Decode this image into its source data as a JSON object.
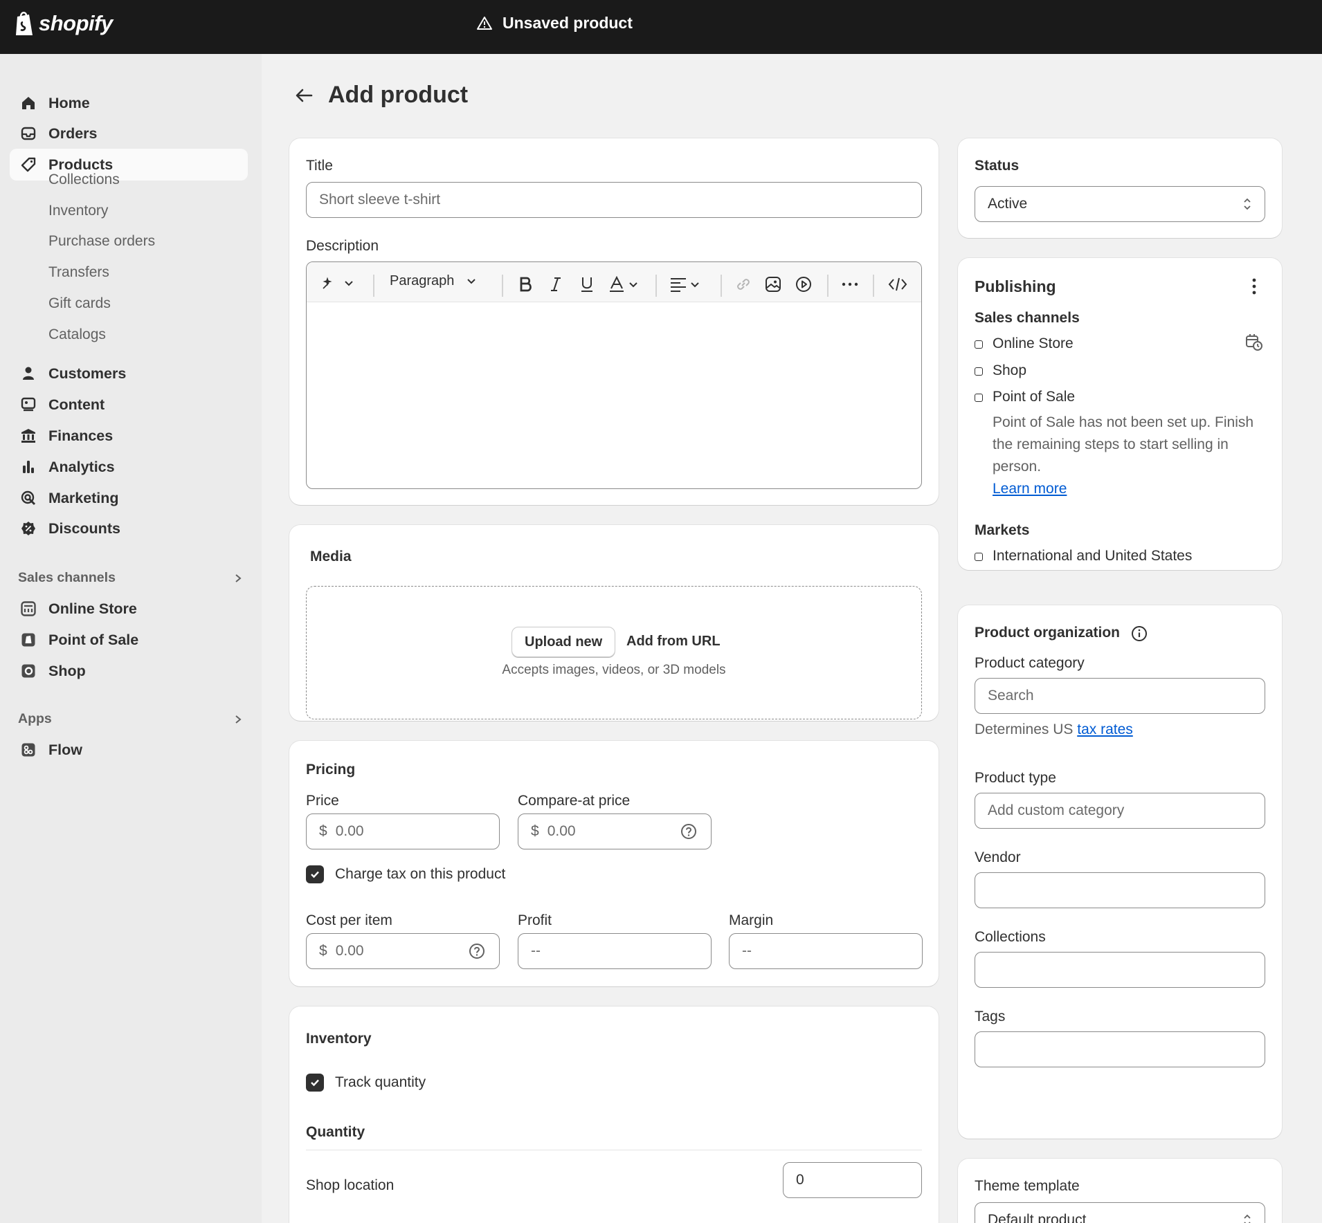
{
  "topbar": {
    "logo_text": "shopify",
    "status_text": "Unsaved product"
  },
  "sidebar": {
    "items": [
      {
        "label": "Home",
        "icon": "home-icon"
      },
      {
        "label": "Orders",
        "icon": "inbox-icon"
      },
      {
        "label": "Products",
        "icon": "tag-icon",
        "active": true
      },
      {
        "label": "Customers",
        "icon": "person-icon"
      },
      {
        "label": "Content",
        "icon": "image-icon"
      },
      {
        "label": "Finances",
        "icon": "bank-icon"
      },
      {
        "label": "Analytics",
        "icon": "bar-chart-icon"
      },
      {
        "label": "Marketing",
        "icon": "target-icon"
      },
      {
        "label": "Discounts",
        "icon": "discount-icon"
      }
    ],
    "product_subitems": [
      "Collections",
      "Inventory",
      "Purchase orders",
      "Transfers",
      "Gift cards",
      "Catalogs"
    ],
    "sales_channels_title": "Sales channels",
    "sales_channels": [
      {
        "label": "Online Store",
        "icon": "store-icon"
      },
      {
        "label": "Point of Sale",
        "icon": "pos-icon"
      },
      {
        "label": "Shop",
        "icon": "shop-icon"
      }
    ],
    "apps_title": "Apps",
    "apps": [
      {
        "label": "Flow",
        "icon": "flow-icon"
      }
    ]
  },
  "page": {
    "title": "Add product"
  },
  "details": {
    "title_label": "Title",
    "title_placeholder": "Short sleeve t-shirt",
    "description_label": "Description",
    "format_value": "Paragraph"
  },
  "media": {
    "title": "Media",
    "upload_label": "Upload new",
    "url_label": "Add from URL",
    "hint": "Accepts images, videos, or 3D models"
  },
  "pricing": {
    "title": "Pricing",
    "price_label": "Price",
    "compare_label": "Compare-at price",
    "currency": "$",
    "price_placeholder": "0.00",
    "compare_placeholder": "0.00",
    "charge_tax_label": "Charge tax on this product",
    "charge_tax_checked": true,
    "cost_label": "Cost per item",
    "cost_placeholder": "0.00",
    "profit_label": "Profit",
    "profit_value": "--",
    "margin_label": "Margin",
    "margin_value": "--"
  },
  "inventory": {
    "title": "Inventory",
    "track_label": "Track quantity",
    "track_checked": true,
    "quantity_title": "Quantity",
    "location_label": "Shop location",
    "location_qty": "0"
  },
  "status": {
    "title": "Status",
    "value": "Active"
  },
  "publishing": {
    "title": "Publishing",
    "channels_title": "Sales channels",
    "channels": [
      "Online Store",
      "Shop",
      "Point of Sale"
    ],
    "pos_note": "Point of Sale has not been set up. Finish the remaining steps to start selling in person.",
    "learn_more": "Learn more",
    "markets_title": "Markets",
    "market": "International and United States"
  },
  "organization": {
    "title": "Product organization",
    "category_label": "Product category",
    "category_placeholder": "Search",
    "tax_note_prefix": "Determines US",
    "tax_link": "tax rates",
    "type_label": "Product type",
    "type_placeholder": "Add custom category",
    "vendor_label": "Vendor",
    "collections_label": "Collections",
    "tags_label": "Tags"
  },
  "theme": {
    "title": "Theme template",
    "value": "Default product"
  }
}
